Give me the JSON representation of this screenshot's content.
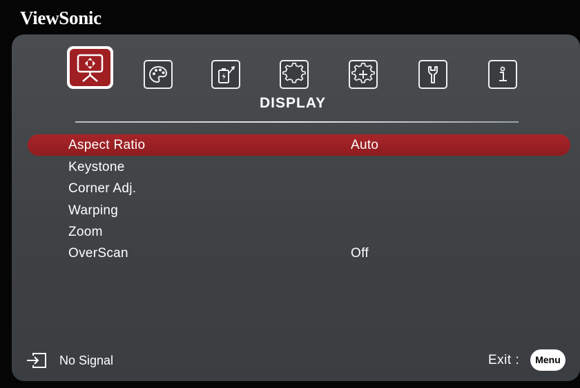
{
  "brand": "ViewSonic",
  "tabs": [
    {
      "icon": "display-icon",
      "active": true
    },
    {
      "icon": "palette-icon",
      "active": false
    },
    {
      "icon": "power-settings-icon",
      "active": false
    },
    {
      "icon": "gear-icon",
      "active": false
    },
    {
      "icon": "advanced-gear-icon",
      "active": false
    },
    {
      "icon": "wrench-icon",
      "active": false
    },
    {
      "icon": "info-icon",
      "active": false
    }
  ],
  "category_title": "DISPLAY",
  "menu_items": [
    {
      "label": "Aspect Ratio",
      "value": "Auto",
      "selected": true
    },
    {
      "label": "Keystone",
      "value": ""
    },
    {
      "label": "Corner Adj.",
      "value": ""
    },
    {
      "label": "Warping",
      "value": ""
    },
    {
      "label": "Zoom",
      "value": ""
    },
    {
      "label": "OverScan",
      "value": "Off"
    }
  ],
  "footer": {
    "icon": "input-source-icon",
    "status": "No Signal",
    "exit_label": "Exit :",
    "menu_button": "Menu"
  },
  "colors": {
    "accent": "#9f1f23",
    "panel": "#45484b",
    "background": "#050505",
    "text": "#ffffff"
  }
}
